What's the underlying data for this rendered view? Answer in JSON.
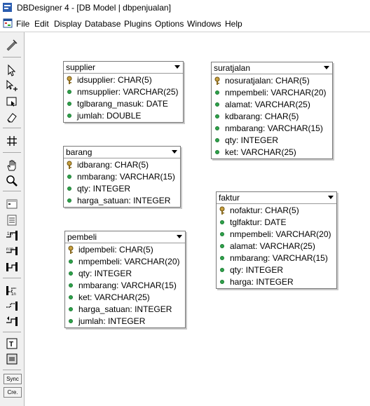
{
  "window": {
    "title": "DBDesigner 4 - [DB Model | dbpenjualan]"
  },
  "menu": [
    "File",
    "Edit",
    "Display",
    "Database",
    "Plugins",
    "Options",
    "Windows",
    "Help"
  ],
  "toolbar": {
    "sync_label": "Sync",
    "cre_label": "Cre."
  },
  "colors": {
    "attribute": "#2ea24a",
    "key": "#c8a040",
    "toolbar_bg": "#f0f0f0"
  },
  "entities": {
    "supplier": {
      "name": "supplier",
      "attrs": [
        "idsupplier: CHAR(5)",
        "nmsupplier: VARCHAR(25)",
        "tglbarang_masuk: DATE",
        "jumlah: DOUBLE"
      ]
    },
    "barang": {
      "name": "barang",
      "attrs": [
        "idbarang: CHAR(5)",
        "nmbarang: VARCHAR(15)",
        "qty: INTEGER",
        "harga_satuan: INTEGER"
      ]
    },
    "pembeli": {
      "name": "pembeli",
      "attrs": [
        "idpembeli: CHAR(5)",
        "nmpembeli: VARCHAR(20)",
        "qty: INTEGER",
        "nmbarang: VARCHAR(15)",
        "ket: VARCHAR(25)",
        "harga_satuan: INTEGER",
        "jumlah: INTEGER"
      ]
    },
    "suratjalan": {
      "name": "suratjalan",
      "attrs": [
        "nosuratjalan: CHAR(5)",
        "nmpembeli: VARCHAR(20)",
        "alamat: VARCHAR(25)",
        "kdbarang: CHAR(5)",
        "nmbarang: VARCHAR(15)",
        "qty: INTEGER",
        "ket: VARCHAR(25)"
      ]
    },
    "faktur": {
      "name": "faktur",
      "attrs": [
        "nofaktur: CHAR(5)",
        "tglfaktur: DATE",
        "nmpembeli: VARCHAR(20)",
        "alamat: VARCHAR(25)",
        "nmbarang: VARCHAR(15)",
        "qty: INTEGER",
        "harga: INTEGER"
      ]
    }
  }
}
